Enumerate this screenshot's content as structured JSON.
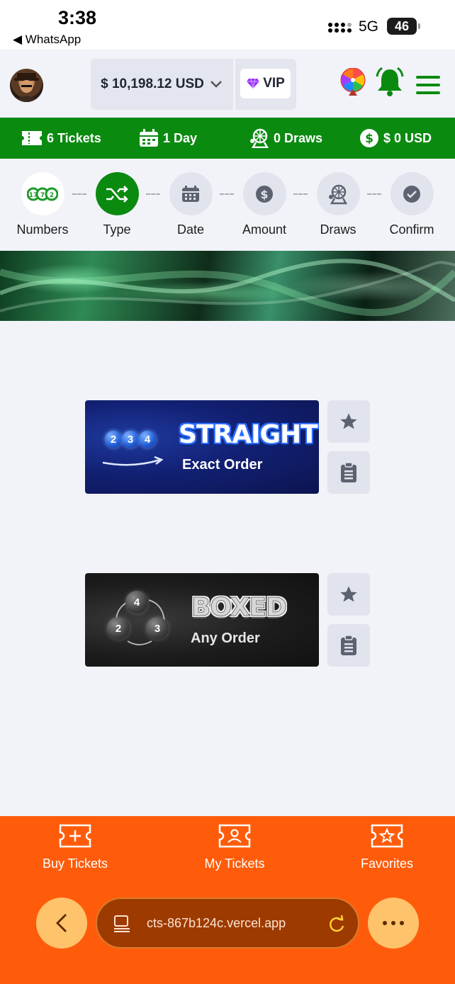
{
  "status_bar": {
    "time": "3:38",
    "back_app": "◀ WhatsApp",
    "network": "5G",
    "battery": "46"
  },
  "header": {
    "balance": "$ 10,198.12 USD",
    "vip_label": "VIP",
    "avatar_icon": "user-avatar",
    "wheel_icon": "prize-wheel-icon",
    "bell_icon": "bell-icon",
    "menu_icon": "hamburger-menu-icon",
    "accent_color": "#0b8a10"
  },
  "summary_bar": {
    "tickets": "6 Tickets",
    "days": "1 Day",
    "draws": "0 Draws",
    "amount": "$ 0 USD"
  },
  "steps": [
    {
      "label": "Numbers",
      "state": "done"
    },
    {
      "label": "Type",
      "state": "active"
    },
    {
      "label": "Date",
      "state": "pending"
    },
    {
      "label": "Amount",
      "state": "pending"
    },
    {
      "label": "Draws",
      "state": "pending"
    },
    {
      "label": "Confirm",
      "state": "pending"
    }
  ],
  "bet_types": [
    {
      "title": "STRAIGHT",
      "subtitle": "Exact Order",
      "balls": [
        "2",
        "3",
        "4"
      ]
    },
    {
      "title": "BOXED",
      "subtitle": "Any Order",
      "balls": [
        "4",
        "2",
        "3"
      ]
    }
  ],
  "bottom_nav": {
    "buy": "Buy Tickets",
    "my": "My Tickets",
    "favorites": "Favorites",
    "bg_color": "#fe5c0b"
  },
  "browser": {
    "url": "cts-867b124c.vercel.app"
  }
}
